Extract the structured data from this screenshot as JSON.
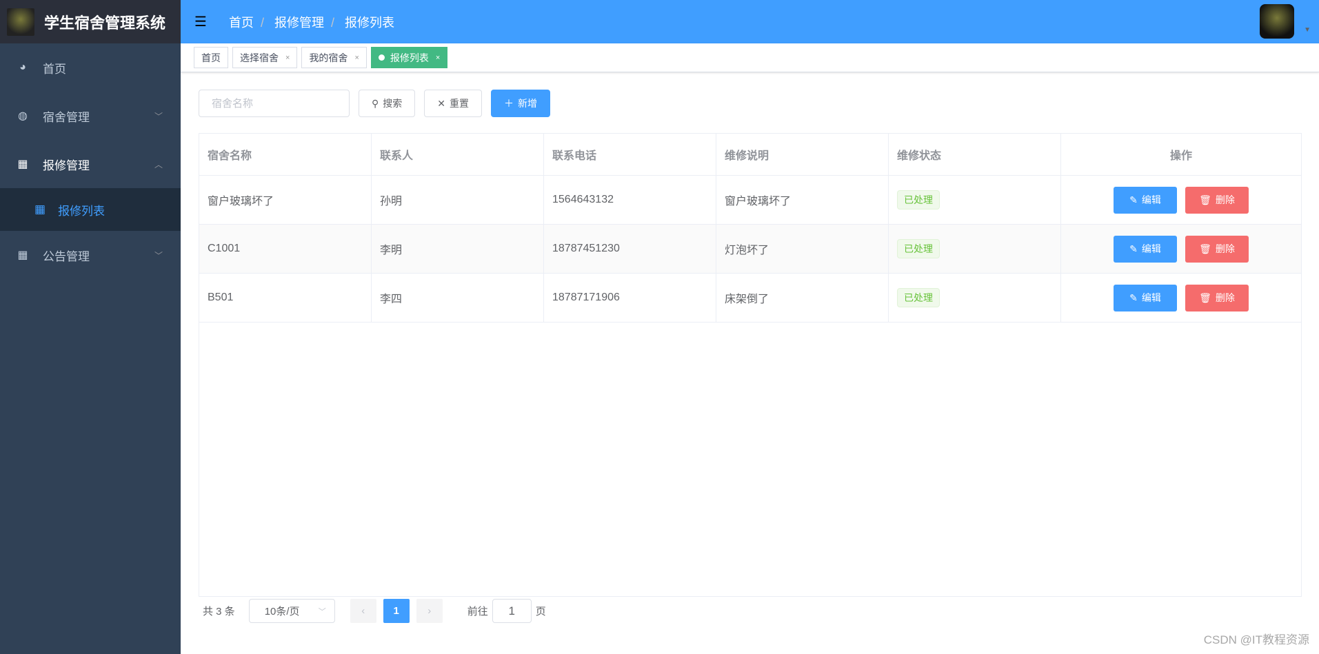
{
  "app": {
    "title": "学生宿舍管理系统"
  },
  "sidebar": {
    "items": [
      {
        "label": "首页",
        "icon": "dashboard-icon"
      },
      {
        "label": "宿舍管理",
        "icon": "circle-icon"
      },
      {
        "label": "报修管理",
        "icon": "table-icon"
      },
      {
        "label": "报修列表",
        "icon": "table-icon"
      },
      {
        "label": "公告管理",
        "icon": "grid-icon"
      }
    ]
  },
  "breadcrumb": [
    "首页",
    "报修管理",
    "报修列表"
  ],
  "tabs": [
    "首页",
    "选择宿舍",
    "我的宿舍",
    "报修列表"
  ],
  "search": {
    "placeholder": "宿舍名称",
    "search": "搜索",
    "reset": "重置",
    "add": "新增"
  },
  "table": {
    "headers": [
      "宿舍名称",
      "联系人",
      "联系电话",
      "维修说明",
      "维修状态",
      "操作"
    ],
    "rows": [
      [
        "窗户玻璃坏了",
        "孙明",
        "1564643132",
        "窗户玻璃坏了",
        "已处理"
      ],
      [
        "C1001",
        "李明",
        "18787451230",
        "灯泡坏了",
        "已处理"
      ],
      [
        "B501",
        "李四",
        "18787171906",
        "床架倒了",
        "已处理"
      ]
    ],
    "edit": "编辑",
    "delete": "删除"
  },
  "pagination": {
    "total": "共 3 条",
    "size": "10条/页",
    "page": "1",
    "goto": "前往",
    "goto_value": "1",
    "page_unit": "页"
  },
  "watermark": "CSDN @IT教程资源",
  "colors": {
    "primary": "#409eff",
    "sidebar": "#304156",
    "active_tab": "#42b983",
    "danger": "#f56c6c",
    "success": "#67c23a"
  }
}
